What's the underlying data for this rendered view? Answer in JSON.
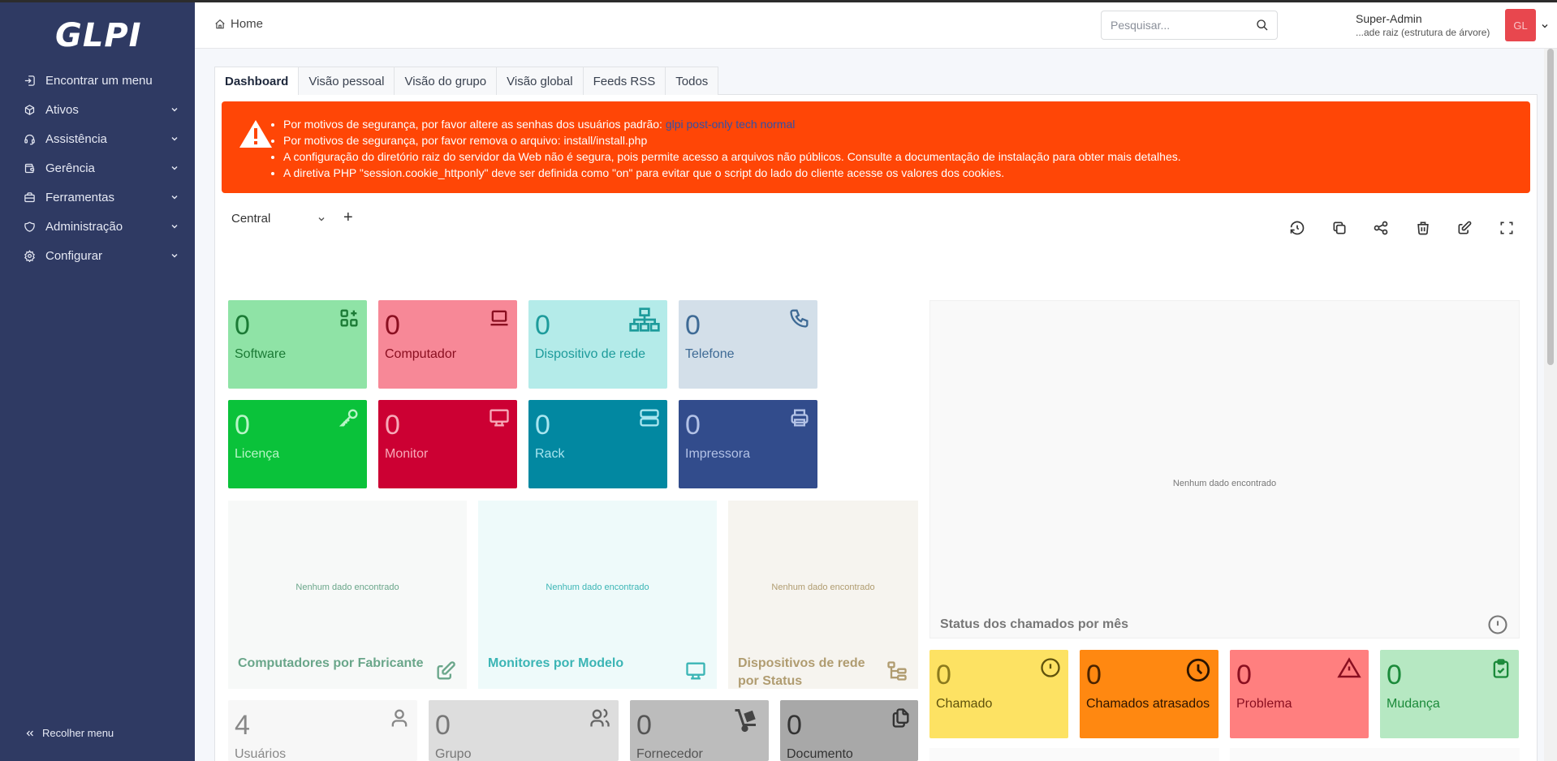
{
  "sidebar": {
    "logo": "GLPI",
    "items": [
      {
        "label": "Encontrar um menu",
        "icon": "arrow-right-icon",
        "has_chevron": false
      },
      {
        "label": "Ativos",
        "icon": "box-icon",
        "has_chevron": true
      },
      {
        "label": "Assistência",
        "icon": "headset-icon",
        "has_chevron": true
      },
      {
        "label": "Gerência",
        "icon": "wallet-icon",
        "has_chevron": true
      },
      {
        "label": "Ferramentas",
        "icon": "briefcase-icon",
        "has_chevron": true
      },
      {
        "label": "Administração",
        "icon": "shield-icon",
        "has_chevron": true
      },
      {
        "label": "Configurar",
        "icon": "gear-icon",
        "has_chevron": true
      }
    ],
    "collapse_label": "Recolher menu"
  },
  "header": {
    "breadcrumb": "Home",
    "search_placeholder": "Pesquisar...",
    "user_name": "Super-Admin",
    "user_entity": "...ade raiz (estrutura de árvore)",
    "avatar_initials": "GL"
  },
  "tabs": [
    "Dashboard",
    "Visão pessoal",
    "Visão do grupo",
    "Visão global",
    "Feeds RSS",
    "Todos"
  ],
  "alert": {
    "line1_prefix": "Por motivos de segurança, por favor altere as senhas dos usuários padrão: ",
    "line1_link": "glpi post-only tech normal",
    "line2": "Por motivos de segurança, por favor remova o arquivo: install/install.php",
    "line3": "A configuração do diretório raiz do servidor da Web não é segura, pois permite acesso a arquivos não públicos. Consulte a documentação de instalação para obter mais detalhes.",
    "line4": "A diretiva PHP \"session.cookie_httponly\" deve ser definida como \"on\" para evitar que o script do lado do cliente acesse os valores dos cookies."
  },
  "dashboard": {
    "selected": "Central",
    "add": "+"
  },
  "cards": [
    {
      "value": "0",
      "label": "Software",
      "icon": "apps-add-icon"
    },
    {
      "value": "0",
      "label": "Computador",
      "icon": "laptop-icon"
    },
    {
      "value": "0",
      "label": "Dispositivo de rede",
      "icon": "network-icon"
    },
    {
      "value": "0",
      "label": "Telefone",
      "icon": "phone-icon"
    },
    {
      "value": "0",
      "label": "Licença",
      "icon": "key-icon"
    },
    {
      "value": "0",
      "label": "Monitor",
      "icon": "monitor-icon"
    },
    {
      "value": "0",
      "label": "Rack",
      "icon": "server-icon"
    },
    {
      "value": "0",
      "label": "Impressora",
      "icon": "printer-icon"
    }
  ],
  "panels": {
    "nodata": "Nenhum dado encontrado",
    "tickets_status": "Status dos chamados por mês",
    "computers_manufacturer": "Computadores por Fabricante",
    "monitors_model": "Monitores por Modelo",
    "netdevices_status": "Dispositivos de rede por Status"
  },
  "ticket_cards": [
    {
      "value": "0",
      "label": "Chamado",
      "icon": "alert-circle-icon"
    },
    {
      "value": "0",
      "label": "Chamados atrasados",
      "icon": "clock-icon"
    },
    {
      "value": "0",
      "label": "Problema",
      "icon": "alert-triangle-icon"
    },
    {
      "value": "0",
      "label": "Mudança",
      "icon": "clipboard-check-icon"
    }
  ],
  "bottom_cards": [
    {
      "value": "4",
      "label": "Usuários",
      "icon": "user-icon"
    },
    {
      "value": "0",
      "label": "Grupo",
      "icon": "users-icon"
    },
    {
      "value": "0",
      "label": "Fornecedor",
      "icon": "dolly-icon"
    },
    {
      "value": "0",
      "label": "Documento",
      "icon": "files-icon"
    }
  ],
  "colors": {
    "sidebar": "#2f3a63",
    "alert": "#ff4606",
    "software": "#8fe3a6",
    "computer": "#f78897",
    "network": "#b4ebe9",
    "phone": "#d3dfe9",
    "license": "#0ac23a",
    "monitor": "#cc0033",
    "rack": "#0288a1",
    "printer": "#324c8c"
  }
}
